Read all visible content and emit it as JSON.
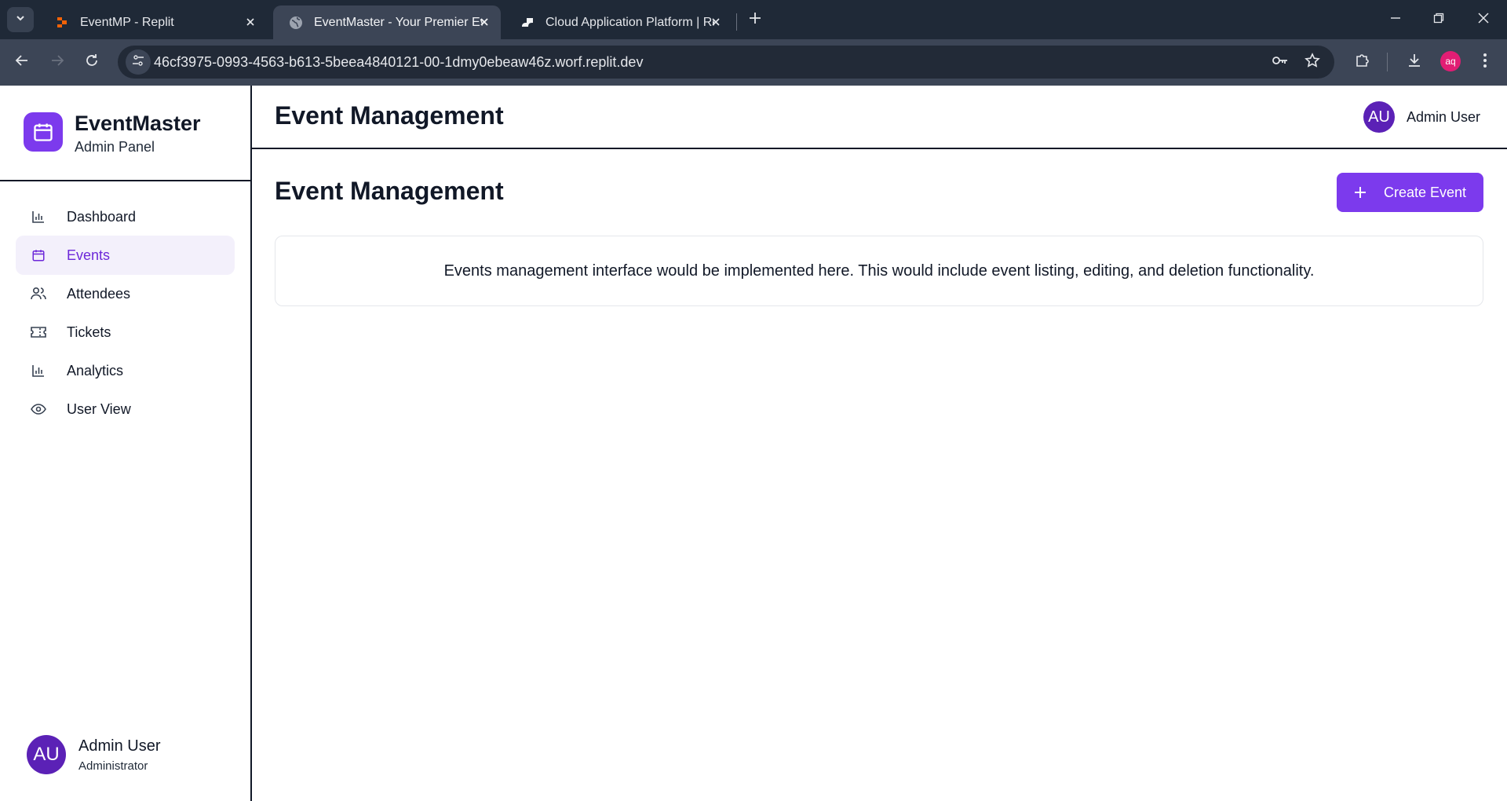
{
  "browser": {
    "tabs": [
      {
        "title": "EventMP - Replit",
        "icon": "replit-icon",
        "active": false
      },
      {
        "title": "EventMaster - Your Premier Eve",
        "icon": "globe-icon",
        "active": true
      },
      {
        "title": "Cloud Application Platform | Re",
        "icon": "replit-cloud-icon",
        "active": false
      }
    ],
    "url": "46cf3975-0993-4563-b613-5beea4840121-00-1dmy0ebeaw46z.worf.replit.dev",
    "profile_initials": "aq"
  },
  "sidebar": {
    "brand_title": "EventMaster",
    "brand_subtitle": "Admin Panel",
    "items": [
      {
        "label": "Dashboard",
        "icon": "bar-chart-icon",
        "active": false
      },
      {
        "label": "Events",
        "icon": "calendar-icon",
        "active": true
      },
      {
        "label": "Attendees",
        "icon": "users-icon",
        "active": false
      },
      {
        "label": "Tickets",
        "icon": "ticket-icon",
        "active": false
      },
      {
        "label": "Analytics",
        "icon": "bar-chart-icon",
        "active": false
      },
      {
        "label": "User View",
        "icon": "eye-icon",
        "active": false
      }
    ],
    "user": {
      "initials": "AU",
      "name": "Admin User",
      "role": "Administrator"
    }
  },
  "header": {
    "title": "Event Management",
    "user": {
      "initials": "AU",
      "name": "Admin User"
    }
  },
  "main": {
    "title": "Event Management",
    "create_button_label": "Create Event",
    "placeholder_message": "Events management interface would be implemented here. This would include event listing, editing, and deletion functionality."
  },
  "colors": {
    "accent": "#7c3aed",
    "avatar": "#5b21b6",
    "active_nav_bg": "#f3f0fb",
    "chrome_dark": "#1f2937"
  }
}
